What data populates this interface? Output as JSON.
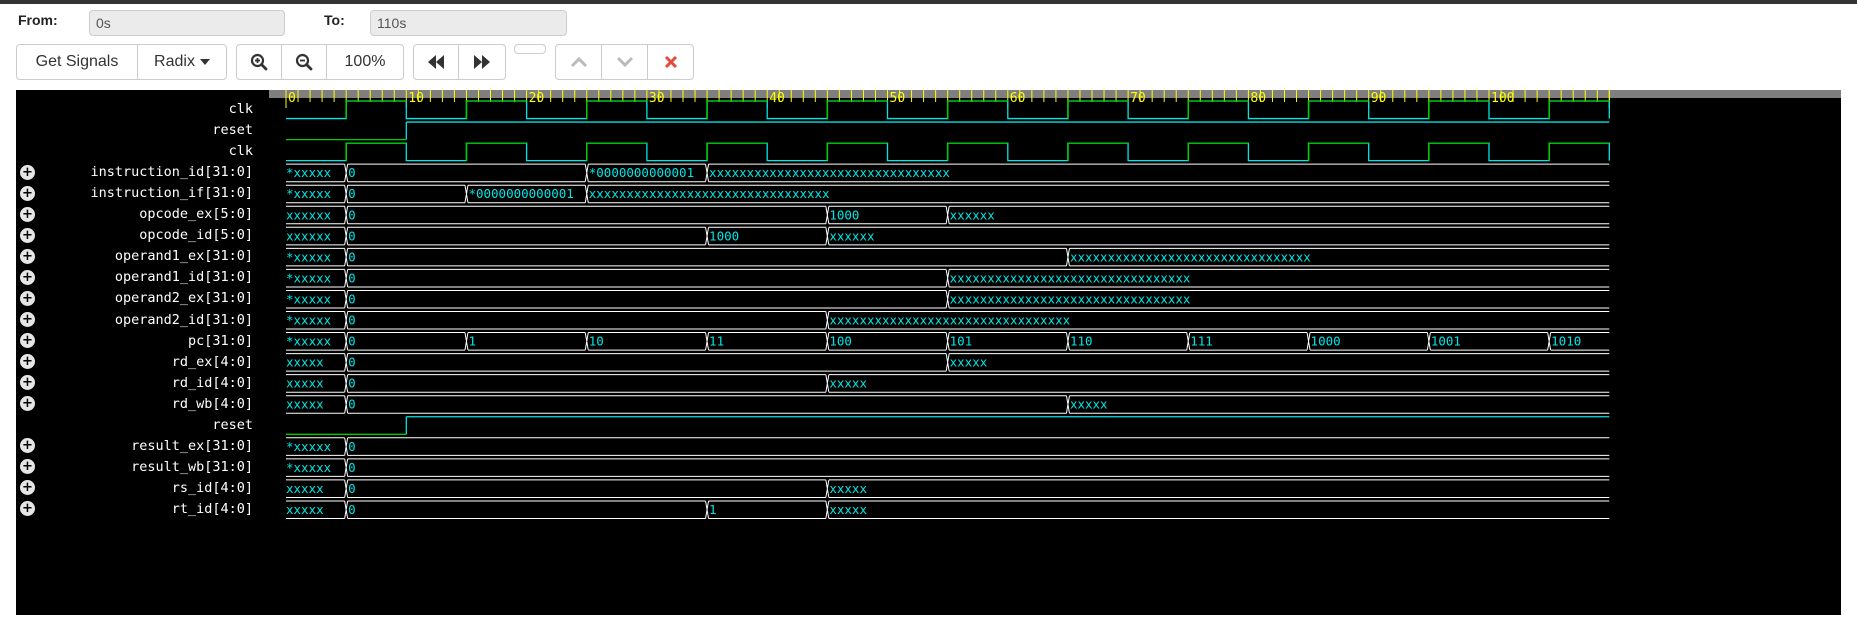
{
  "range": {
    "from_label": "From:",
    "from_value": "0s",
    "to_label": "To:",
    "to_value": "110s"
  },
  "toolbar": {
    "get_signals": "Get Signals",
    "radix": "Radix",
    "zoom_level": "100%"
  },
  "icons": [
    "zoom-in-icon",
    "zoom-out-icon",
    "rewind-icon",
    "fast-forward-icon",
    "chevron-up-icon",
    "chevron-down-icon",
    "close-icon"
  ],
  "colors": {
    "close_icon": "#e8473b",
    "wave": "#00e6e6",
    "rising_edge": "#00cc00",
    "ruler": "#7f7f7f",
    "ruler_text": "#ffff00"
  },
  "timeline": {
    "start": 0,
    "end": 110,
    "ticks": [
      "0",
      "10",
      "20",
      "30",
      "40",
      "50",
      "60",
      "70",
      "80",
      "90",
      "100"
    ]
  },
  "signals": [
    {
      "name": "clk",
      "type": "clock",
      "period": 10,
      "first_rise": 5
    },
    {
      "name": "reset",
      "type": "bit",
      "changes": [
        [
          0,
          0
        ],
        [
          10,
          1
        ]
      ]
    },
    {
      "name": "clk",
      "type": "clock",
      "period": 10,
      "first_rise": 5
    },
    {
      "name": "instruction_id[31:0]",
      "type": "bus",
      "changes": [
        [
          0,
          "*xxxxx"
        ],
        [
          5,
          "0"
        ],
        [
          25,
          "*0000000000001"
        ],
        [
          35,
          "xxxxxxxxxxxxxxxxxxxxxxxxxxxxxxxx"
        ]
      ]
    },
    {
      "name": "instruction_if[31:0]",
      "type": "bus",
      "changes": [
        [
          0,
          "*xxxxx"
        ],
        [
          5,
          "0"
        ],
        [
          15,
          "*0000000000001"
        ],
        [
          25,
          "xxxxxxxxxxxxxxxxxxxxxxxxxxxxxxxx"
        ]
      ]
    },
    {
      "name": "opcode_ex[5:0]",
      "type": "bus",
      "changes": [
        [
          0,
          "xxxxxx"
        ],
        [
          5,
          "0"
        ],
        [
          45,
          "1000"
        ],
        [
          55,
          "xxxxxx"
        ]
      ]
    },
    {
      "name": "opcode_id[5:0]",
      "type": "bus",
      "changes": [
        [
          0,
          "xxxxxx"
        ],
        [
          5,
          "0"
        ],
        [
          35,
          "1000"
        ],
        [
          45,
          "xxxxxx"
        ]
      ]
    },
    {
      "name": "operand1_ex[31:0]",
      "type": "bus",
      "changes": [
        [
          0,
          "*xxxxx"
        ],
        [
          5,
          "0"
        ],
        [
          65,
          "xxxxxxxxxxxxxxxxxxxxxxxxxxxxxxxx"
        ]
      ]
    },
    {
      "name": "operand1_id[31:0]",
      "type": "bus",
      "changes": [
        [
          0,
          "*xxxxx"
        ],
        [
          5,
          "0"
        ],
        [
          55,
          "xxxxxxxxxxxxxxxxxxxxxxxxxxxxxxxx"
        ]
      ]
    },
    {
      "name": "operand2_ex[31:0]",
      "type": "bus",
      "changes": [
        [
          0,
          "*xxxxx"
        ],
        [
          5,
          "0"
        ],
        [
          55,
          "xxxxxxxxxxxxxxxxxxxxxxxxxxxxxxxx"
        ]
      ]
    },
    {
      "name": "operand2_id[31:0]",
      "type": "bus",
      "changes": [
        [
          0,
          "*xxxxx"
        ],
        [
          5,
          "0"
        ],
        [
          45,
          "xxxxxxxxxxxxxxxxxxxxxxxxxxxxxxxx"
        ]
      ]
    },
    {
      "name": "pc[31:0]",
      "type": "bus",
      "changes": [
        [
          0,
          "*xxxxx"
        ],
        [
          5,
          "0"
        ],
        [
          15,
          "1"
        ],
        [
          25,
          "10"
        ],
        [
          35,
          "11"
        ],
        [
          45,
          "100"
        ],
        [
          55,
          "101"
        ],
        [
          65,
          "110"
        ],
        [
          75,
          "111"
        ],
        [
          85,
          "1000"
        ],
        [
          95,
          "1001"
        ],
        [
          105,
          "1010"
        ]
      ]
    },
    {
      "name": "rd_ex[4:0]",
      "type": "bus",
      "changes": [
        [
          0,
          "xxxxx"
        ],
        [
          5,
          "0"
        ],
        [
          55,
          "xxxxx"
        ]
      ]
    },
    {
      "name": "rd_id[4:0]",
      "type": "bus",
      "changes": [
        [
          0,
          "xxxxx"
        ],
        [
          5,
          "0"
        ],
        [
          45,
          "xxxxx"
        ]
      ]
    },
    {
      "name": "rd_wb[4:0]",
      "type": "bus",
      "changes": [
        [
          0,
          "xxxxx"
        ],
        [
          5,
          "0"
        ],
        [
          65,
          "xxxxx"
        ]
      ]
    },
    {
      "name": "reset",
      "type": "bit",
      "changes": [
        [
          0,
          0
        ],
        [
          10,
          1
        ]
      ]
    },
    {
      "name": "result_ex[31:0]",
      "type": "bus",
      "changes": [
        [
          0,
          "*xxxxx"
        ],
        [
          5,
          "0"
        ]
      ]
    },
    {
      "name": "result_wb[31:0]",
      "type": "bus",
      "changes": [
        [
          0,
          "*xxxxx"
        ],
        [
          5,
          "0"
        ]
      ]
    },
    {
      "name": "rs_id[4:0]",
      "type": "bus",
      "changes": [
        [
          0,
          "xxxxx"
        ],
        [
          5,
          "0"
        ],
        [
          45,
          "xxxxx"
        ]
      ]
    },
    {
      "name": "rt_id[4:0]",
      "type": "bus",
      "changes": [
        [
          0,
          "xxxxx"
        ],
        [
          5,
          "0"
        ],
        [
          35,
          "1"
        ],
        [
          45,
          "xxxxx"
        ]
      ]
    }
  ]
}
